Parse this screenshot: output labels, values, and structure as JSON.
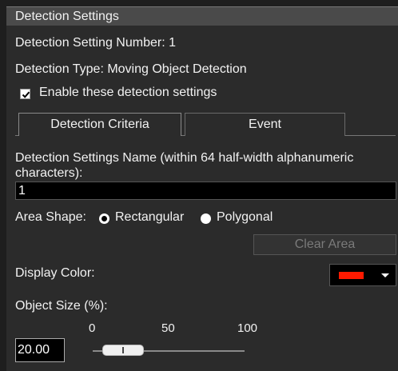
{
  "header": {
    "title": "Detection Settings"
  },
  "info": {
    "setting_number": "Detection Setting Number: 1",
    "type": "Detection Type: Moving Object Detection"
  },
  "enable": {
    "label": "Enable these detection settings",
    "checked": true
  },
  "tabs": [
    {
      "label": "Detection Criteria",
      "active": true
    },
    {
      "label": "Event",
      "active": false
    }
  ],
  "name_field": {
    "label": "Detection Settings Name (within 64 half-width alphanumeric characters):",
    "value": "1"
  },
  "area_shape": {
    "label": "Area Shape:",
    "options": [
      {
        "label": "Rectangular",
        "selected": true
      },
      {
        "label": "Polygonal",
        "selected": false
      }
    ]
  },
  "clear_area": {
    "label": "Clear Area",
    "enabled": false
  },
  "display_color": {
    "label": "Display Color:",
    "value": "#ff1a00"
  },
  "object_size": {
    "label": "Object Size (%):",
    "value": "20.00",
    "scale_labels": [
      "0",
      "50",
      "100"
    ],
    "slider_value_percent": 20
  }
}
